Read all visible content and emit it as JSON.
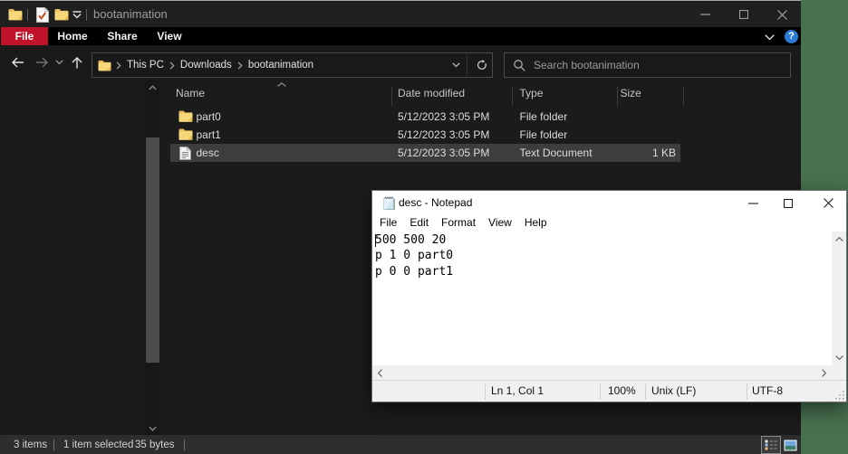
{
  "colors": {
    "desktop_green": "#48714f",
    "file_tab_red": "#c01228",
    "help_blue": "#2a7cd4",
    "selection_gray": "#3d3d3d",
    "folder_yellow": "#f6d779"
  },
  "explorer": {
    "window_title": "bootanimation",
    "ribbon_tabs": {
      "file": "File",
      "home": "Home",
      "share": "Share",
      "view": "View"
    },
    "breadcrumb": {
      "items": [
        "This PC",
        "Downloads",
        "bootanimation"
      ]
    },
    "search_placeholder": "Search bootanimation",
    "help_label": "?",
    "list": {
      "columns": {
        "name": "Name",
        "date": "Date modified",
        "type": "Type",
        "size": "Size"
      },
      "rows": [
        {
          "name": "part0",
          "date": "5/12/2023 3:05 PM",
          "type": "File folder",
          "size": ""
        },
        {
          "name": "part1",
          "date": "5/12/2023 3:05 PM",
          "type": "File folder",
          "size": ""
        },
        {
          "name": "desc",
          "date": "5/12/2023 3:05 PM",
          "type": "Text Document",
          "size": "1 KB"
        }
      ]
    },
    "statusbar": {
      "items_count": "3 items",
      "selection": "1 item selected",
      "selection_size": "35 bytes"
    }
  },
  "notepad": {
    "window_title": "desc - Notepad",
    "menu": [
      "File",
      "Edit",
      "Format",
      "View",
      "Help"
    ],
    "lines": [
      "500 500 20",
      "p 1 0 part0",
      "p 0 0 part1"
    ],
    "statusbar": {
      "cursor": "Ln 1, Col 1",
      "zoom": "100%",
      "line_ending": "Unix (LF)",
      "encoding": "UTF-8"
    }
  }
}
